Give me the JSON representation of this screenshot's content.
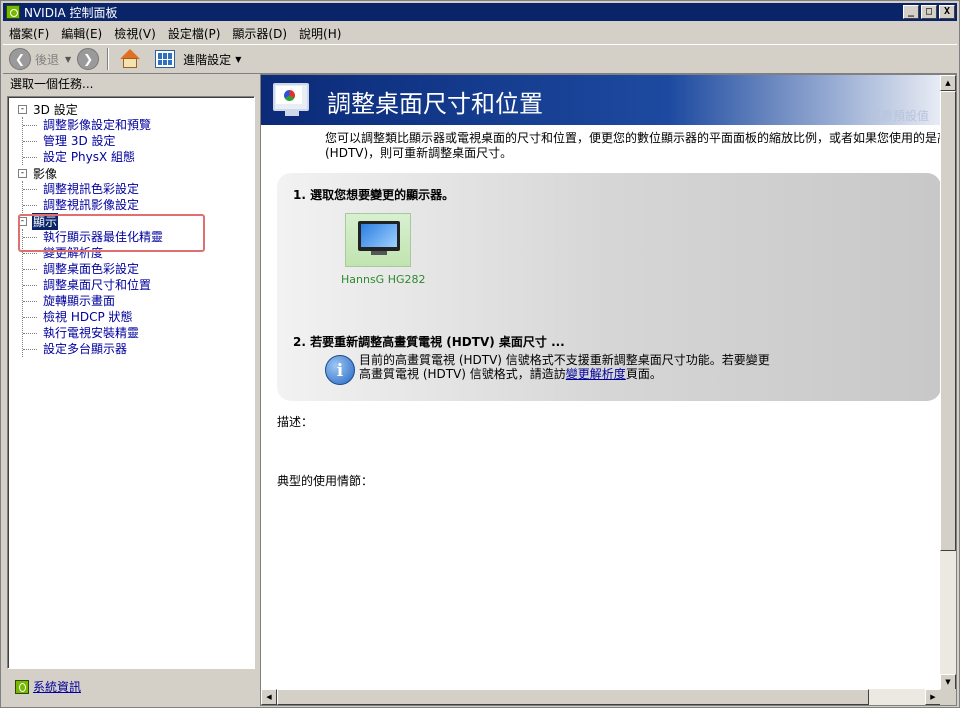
{
  "window": {
    "title": "NVIDIA 控制面板",
    "minimize": "_",
    "maximize": "□",
    "close": "X"
  },
  "menubar": [
    "檔案(F)",
    "編輯(E)",
    "檢視(V)",
    "設定檔(P)",
    "顯示器(D)",
    "說明(H)"
  ],
  "toolbar": {
    "back_label": "後退",
    "advanced_label": "進階設定"
  },
  "left_pane": {
    "header": "選取一個任務...",
    "tree": [
      {
        "label": "3D 設定",
        "items": [
          "調整影像設定和預覽",
          "管理 3D 設定",
          "設定 PhysX 組態"
        ]
      },
      {
        "label": "影像",
        "items": [
          "調整視訊色彩設定",
          "調整視訊影像設定"
        ]
      },
      {
        "label": "顯示",
        "items": [
          "執行顯示器最佳化精靈",
          "變更解析度",
          "調整桌面色彩設定",
          "調整桌面尺寸和位置",
          "旋轉顯示畫面",
          "檢視 HDCP 狀態",
          "執行電視安裝精靈",
          "設定多台顯示器"
        ]
      }
    ],
    "sysinfo": "系統資訊"
  },
  "main": {
    "title": "調整桌面尺寸和位置",
    "restore_defaults": "還原預設值",
    "intro_line1": "您可以調整類比顯示器或電視桌面的尺寸和位置，便更您的數位顯示器的平面面板的縮放比例，或者如果您使用的是高",
    "intro_line2": "(HDTV)，則可重新調整桌面尺寸。",
    "step1": "1. 選取您想要變更的顯示器。",
    "display_name": "HannsG HG282",
    "step2": "2. 若要重新調整高畫質電視 (HDTV) 桌面尺寸 ...",
    "info_line1": "目前的高畫質電視 (HDTV) 信號格式不支援重新調整桌面尺寸功能。若要變更",
    "info_line2_pre": "高畫質電視 (HDTV) 信號格式，請造訪",
    "info_link": "變更解析度",
    "info_line2_post": "頁面。",
    "description_label": "描述：",
    "usage_label": "典型的使用情節："
  },
  "colors": {
    "title_bar": "#0a246a",
    "link": "#00009c",
    "highlight_box": "#e07070",
    "display_label": "#2e8b2e"
  }
}
